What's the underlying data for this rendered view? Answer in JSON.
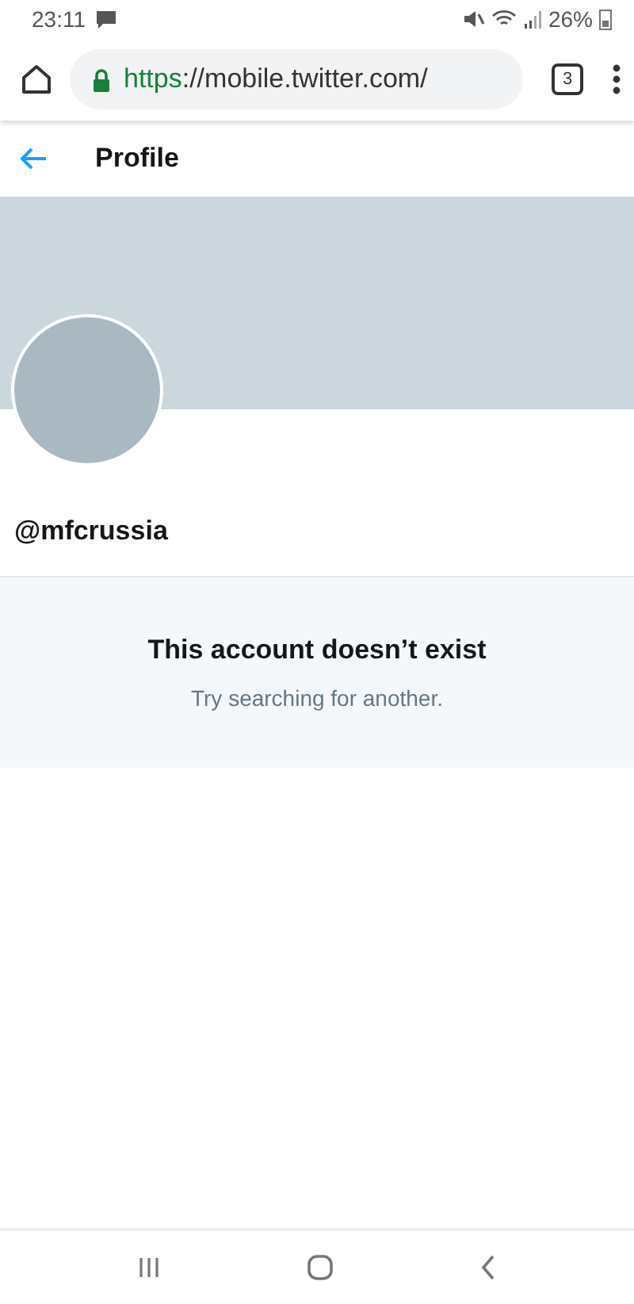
{
  "status_bar": {
    "time": "23:11",
    "battery": "26%"
  },
  "browser": {
    "url_scheme": "https",
    "url_rest": "://mobile.twitter.com/",
    "tab_count": "3"
  },
  "header": {
    "title": "Profile"
  },
  "profile": {
    "handle": "@mfcrussia"
  },
  "empty_state": {
    "title": "This account doesn’t exist",
    "subtitle": "Try searching for another."
  }
}
